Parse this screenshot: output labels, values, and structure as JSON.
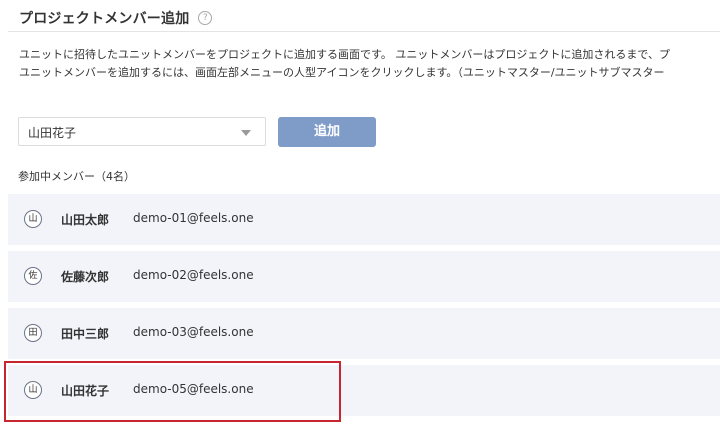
{
  "header": {
    "title": "プロジェクトメンバー追加",
    "help_icon": "?"
  },
  "description": {
    "line1": "ユニットに招待したユニットメンバーをプロジェクトに追加する画面です。 ユニットメンバーはプロジェクトに追加されるまで、プ",
    "line2": "ユニットメンバーを追加するには、画面左部メニューの人型アイコンをクリックします。（ユニットマスター/ユニットサブマスター"
  },
  "form": {
    "selected_member": "山田花子",
    "add_label": "追加"
  },
  "members": {
    "heading": "参加中メンバー（4名）",
    "items": [
      {
        "avatar": "山",
        "name": "山田太郎",
        "email": "demo-01@feels.one"
      },
      {
        "avatar": "佐",
        "name": "佐藤次郎",
        "email": "demo-02@feels.one"
      },
      {
        "avatar": "田",
        "name": "田中三郎",
        "email": "demo-03@feels.one"
      },
      {
        "avatar": "山",
        "name": "山田花子",
        "email": "demo-05@feels.one"
      }
    ]
  },
  "colors": {
    "accent_button": "#7f9cc9",
    "row_background": "#f2f4fa",
    "highlight": "#c8262e"
  }
}
